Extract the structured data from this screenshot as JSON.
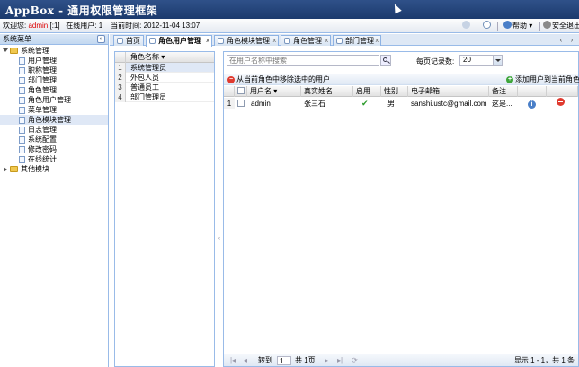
{
  "header": {
    "app_title": "AppBox - 通用权限管理框架"
  },
  "status": {
    "welcome_label": "欢迎您:",
    "username": "admin",
    "user_suffix": "[:1]",
    "online_label": "在线用户:",
    "online_count": "1",
    "time_label": "当前时间:",
    "time_value": "2012-11-04 13:07",
    "help_label": "帮助",
    "logout_label": "安全退出"
  },
  "sidebar": {
    "title": "系统菜单",
    "collapse_glyph": "«",
    "groups": [
      {
        "label": "系统管理",
        "items": [
          "用户管理",
          "职称管理",
          "部门管理",
          "角色管理",
          "角色用户管理",
          "菜单管理",
          "角色模块管理",
          "日志管理",
          "系统配置",
          "修改密码",
          "在线统计"
        ]
      },
      {
        "label": "其他模块"
      }
    ]
  },
  "tabs": [
    {
      "label": "首页"
    },
    {
      "label": "角色用户管理"
    },
    {
      "label": "角色模块管理"
    },
    {
      "label": "角色管理"
    },
    {
      "label": "部门管理"
    }
  ],
  "roles_grid": {
    "header": "角色名称",
    "rows": [
      {
        "num": "1",
        "name": "系统管理员"
      },
      {
        "num": "2",
        "name": "外包人员"
      },
      {
        "num": "3",
        "name": "普通员工"
      },
      {
        "num": "4",
        "name": "部门管理员"
      }
    ]
  },
  "users_panel": {
    "search_placeholder": "在用户名称中搜索",
    "page_size_label": "每页记录数:",
    "page_size_value": "20",
    "remove_button": "从当前角色中移除选中的用户",
    "add_button": "添加用户到当前角色",
    "columns": [
      "用户名",
      "真实姓名",
      "启用",
      "性别",
      "电子邮箱",
      "备注"
    ],
    "rows": [
      {
        "num": "1",
        "username": "admin",
        "realname": "张三石",
        "gender": "男",
        "email": "sanshi.ustc@gmail.com",
        "remark": "这是..."
      }
    ],
    "pager": {
      "goto_label": "转到",
      "page_input": "1",
      "total_pages": "共 1页",
      "summary": "显示 1 - 1，共 1 条"
    }
  },
  "colors": {
    "header_bg": "#1c3a6d",
    "accent": "#99bbe8",
    "selected_row": "#dfe8f6",
    "admin_text": "#dd0000"
  }
}
